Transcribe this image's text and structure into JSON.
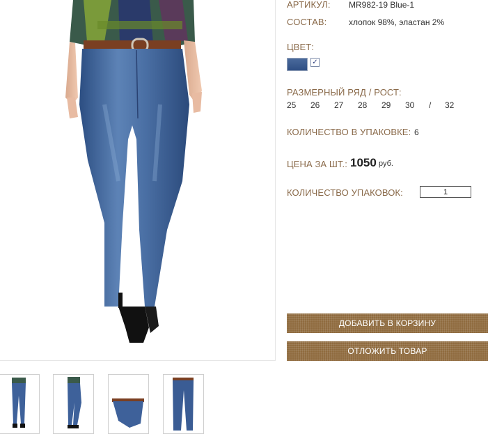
{
  "product": {
    "article_label": "АРТИКУЛ:",
    "article_value": "MR982-19 Blue-1",
    "composition_label": "СОСТАВ:",
    "composition_value": "хлопок 98%, эластан 2%",
    "color_label": "ЦВЕТ:",
    "color_swatch": "#3b5b8f",
    "color_checked_glyph": "✓",
    "sizes_label": "РАЗМЕРНЫЙ РЯД / РОСТ:",
    "sizes": [
      "25",
      "26",
      "27",
      "28",
      "29",
      "30",
      "/",
      "32"
    ],
    "pack_qty_label": "КОЛИЧЕСТВО В УПАКОВКЕ:",
    "pack_qty_value": "6",
    "price_label": "ЦЕНА ЗА ШТ.:",
    "price_value": "1050",
    "price_currency": "руб.",
    "packs_label": "КОЛИЧЕСТВО УПАКОВОК:",
    "packs_value": "1"
  },
  "actions": {
    "add_to_cart": "ДОБАВИТЬ В КОРЗИНУ",
    "save_item": "ОТЛОЖИТЬ ТОВАР"
  },
  "colors": {
    "label": "#8a6a4a",
    "button": "#8f6b3e",
    "denim": "#3b5b8f"
  },
  "thumbnails": [
    "front-view",
    "side-view",
    "waist-detail",
    "flat-view"
  ]
}
